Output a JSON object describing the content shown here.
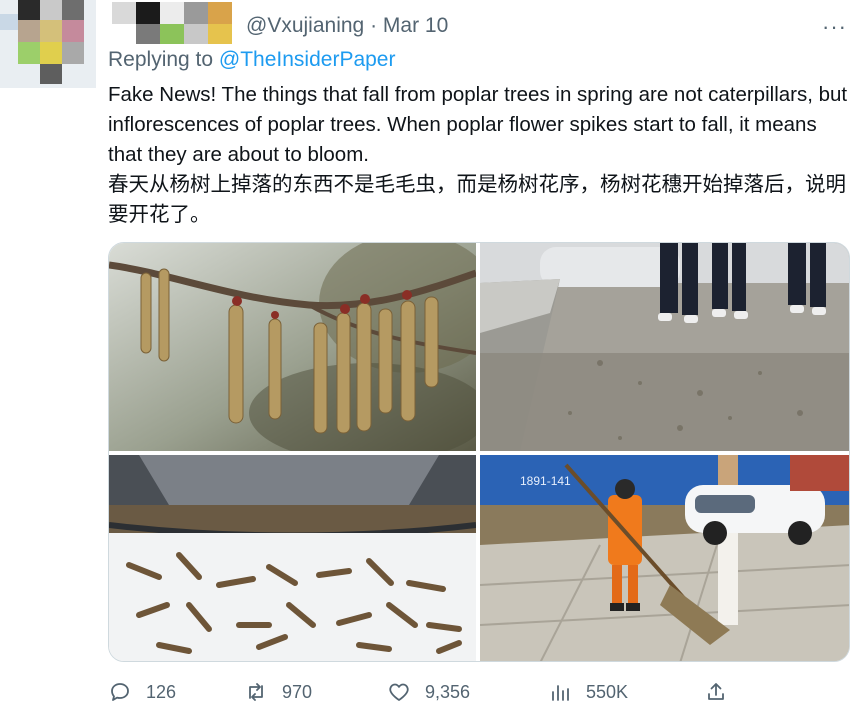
{
  "author": {
    "handle": "@Vxujianing",
    "separator": "·",
    "date": "Mar 10"
  },
  "reply": {
    "prefix": "Replying to",
    "target": "@TheInsiderPaper"
  },
  "tweet": {
    "text_en": "Fake News!  The things that fall from poplar trees in spring are not caterpillars, but inflorescences of poplar trees. When poplar flower spikes start to fall, it means that they are about to bloom.",
    "text_zh": "春天从杨树上掉落的东西不是毛毛虫，而是杨树花序，杨树花穗开始掉落后，说明要开花了。"
  },
  "media": {
    "photo_4_sign": "1891-141"
  },
  "actions": {
    "replies": "126",
    "retweets": "970",
    "likes": "9,356",
    "views": "550K"
  },
  "colors": {
    "accent": "#1d9bf0",
    "secondary_text": "#536471",
    "primary_text": "#0f1419"
  },
  "icons": [
    "more-icon",
    "reply-icon",
    "retweet-icon",
    "like-icon",
    "views-icon",
    "share-icon"
  ]
}
